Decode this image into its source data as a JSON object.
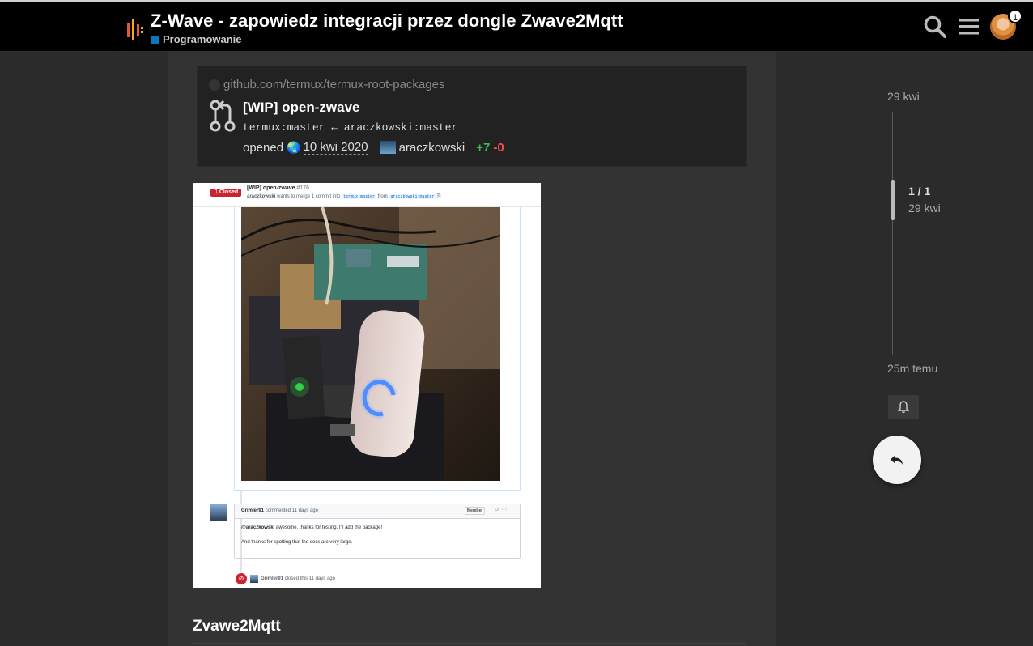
{
  "header": {
    "title": "Z-Wave - zapowiedz integracji przez dongle Zwave2Mqtt",
    "category": "Programowanie",
    "category_color": "#0e76bd",
    "notifications_count": "1",
    "icons": [
      "discourse-logo-icon",
      "search-icon",
      "hamburger-menu-icon",
      "user-avatar"
    ]
  },
  "onebox": {
    "source": "github.com/termux/termux-root-packages",
    "title": "[WIP] open-zwave",
    "branches": "termux:master ← araczkowski:master",
    "opened_label": "opened",
    "date": "10 kwi 2020",
    "user": "araczkowski",
    "additions": "+7",
    "deletions": "-0"
  },
  "screenshot": {
    "status": "Closed",
    "title": "[WIP] open-zwave",
    "number": "#176",
    "author": "araczkowski",
    "merge_text": "wants to merge 1 commit into",
    "target_branch": "termux:master",
    "from_text": "from",
    "source_branch": "araczkowski:master",
    "comment_author": "Grimler91",
    "comment_meta": "commented 11 days ago",
    "member_label": "Member",
    "comment_mention": "@araczkowski",
    "comment_line1": "awesome, thanks for testing, I'll add the package!",
    "comment_line2": "And thanks for spotting that the docs are very large.",
    "closed_by": "Grimler91",
    "closed_text": "closed this 11 days ago"
  },
  "post": {
    "heading": "Zvawe2Mqtt"
  },
  "timeline": {
    "top_date": "29 kwi",
    "position": "1 / 1",
    "position_date": "29 kwi",
    "bottom_date": "25m temu"
  }
}
